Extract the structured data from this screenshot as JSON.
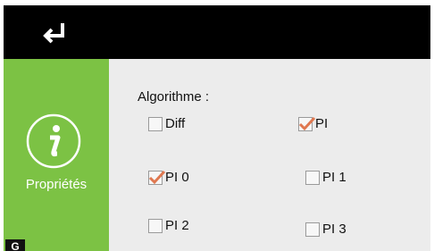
{
  "sidebar": {
    "label": "Propriétés",
    "badge": "G"
  },
  "main": {
    "section_label": "Algorithme :",
    "options": [
      {
        "label": "Diff",
        "checked": false
      },
      {
        "label": "PI",
        "checked": true
      },
      {
        "label": "PI 0",
        "checked": true
      },
      {
        "label": "PI 1",
        "checked": false
      },
      {
        "label": "PI 2",
        "checked": false
      },
      {
        "label": "PI 3",
        "checked": false
      }
    ]
  },
  "colors": {
    "sidebar_green": "#7cc244",
    "check_mark": "#e07850",
    "content_bg": "#ececec"
  },
  "icons": {
    "back": "return-arrow-icon",
    "info": "info-circle-icon"
  }
}
